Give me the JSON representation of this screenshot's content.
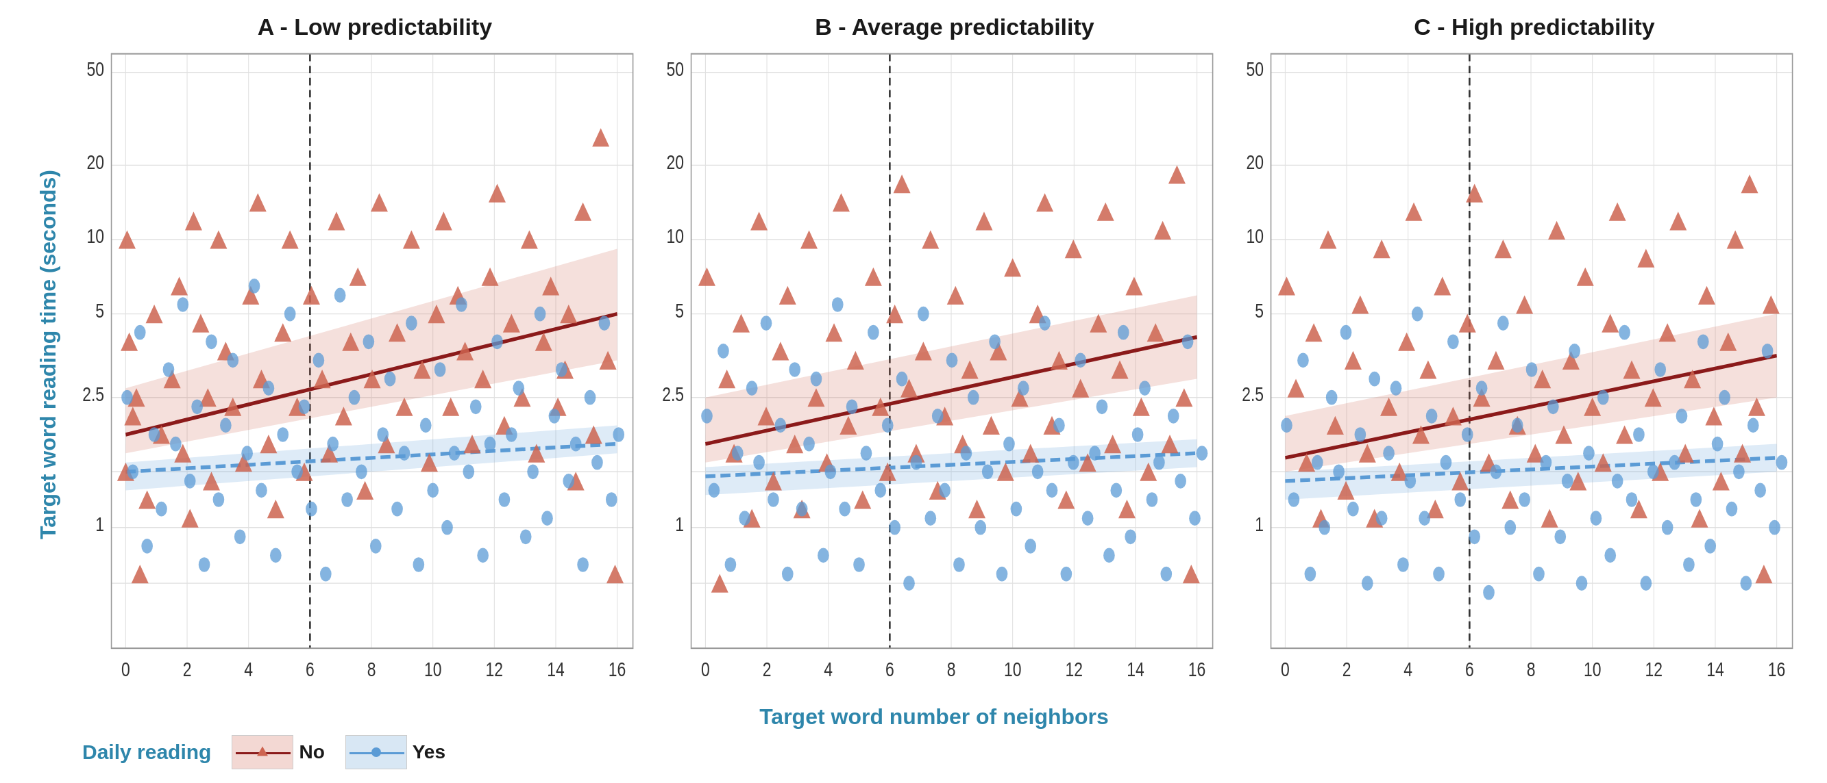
{
  "figure": {
    "yAxisLabel": "Target word reading time (seconds)",
    "xAxisLabel": "Target word number of neighbors",
    "panels": [
      {
        "id": "A",
        "title": "A - Low predictability",
        "xTicks": [
          "0",
          "2",
          "4",
          "6",
          "8",
          "10",
          "12",
          "14",
          "16"
        ],
        "yTicks": [
          "1",
          "2.5",
          "5",
          "10",
          "20",
          "50"
        ],
        "verticalLineX": 6
      },
      {
        "id": "B",
        "title": "B - Average predictability",
        "xTicks": [
          "0",
          "2",
          "4",
          "6",
          "8",
          "10",
          "12",
          "14",
          "16"
        ],
        "yTicks": [
          "1",
          "2.5",
          "5",
          "10",
          "20",
          "50"
        ],
        "verticalLineX": 6
      },
      {
        "id": "C",
        "title": "C - High predictability",
        "xTicks": [
          "0",
          "2",
          "4",
          "6",
          "8",
          "10",
          "12",
          "14",
          "16"
        ],
        "yTicks": [
          "1",
          "2.5",
          "5",
          "10",
          "20",
          "50"
        ],
        "verticalLineX": 6
      }
    ],
    "legend": {
      "title": "Daily reading",
      "items": [
        {
          "label": "No",
          "color": "red"
        },
        {
          "label": "Yes",
          "color": "blue"
        }
      ]
    }
  }
}
